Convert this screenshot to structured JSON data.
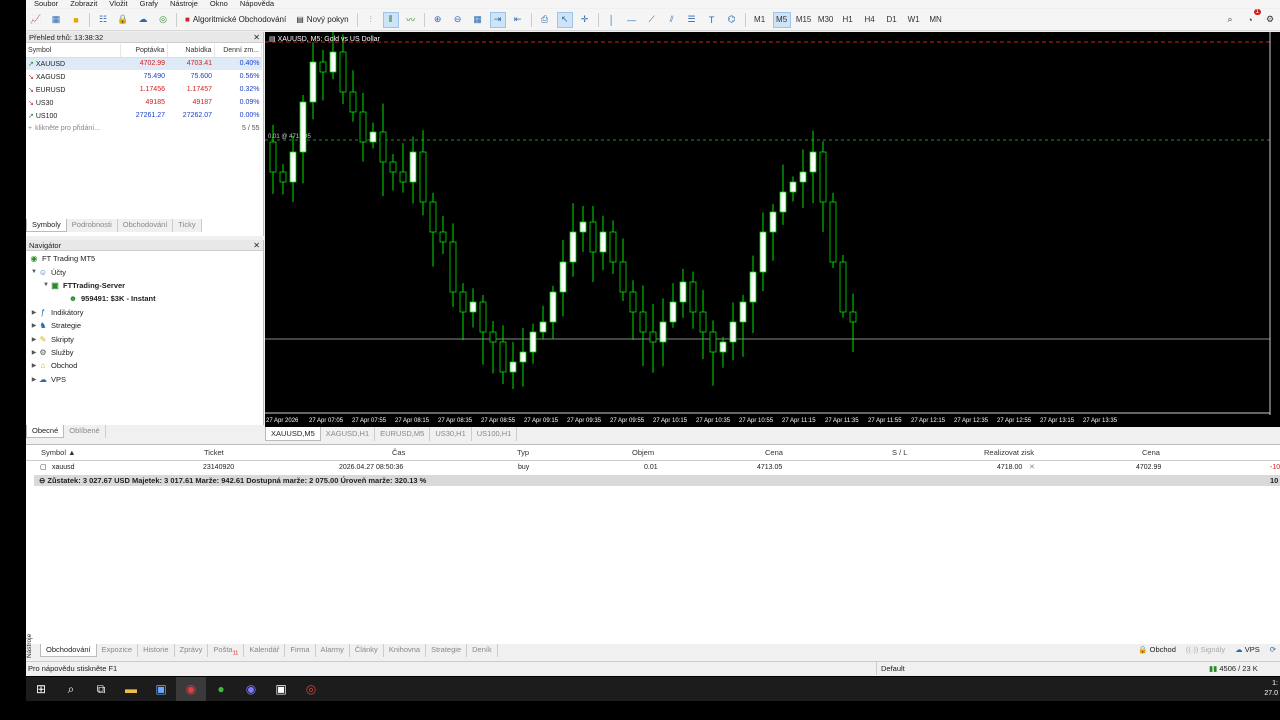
{
  "menu": [
    "Soubor",
    "Zobrazit",
    "Vložit",
    "Grafy",
    "Nástroje",
    "Okno",
    "Nápověda"
  ],
  "toolbar": {
    "algo_label": "Algoritmické Obchodování",
    "new_order_label": "Nový pokyn",
    "timeframes": [
      "M1",
      "M5",
      "M15",
      "M30",
      "H1",
      "H4",
      "D1",
      "W1",
      "MN"
    ],
    "active_timeframe": "M5",
    "notification_count": "1"
  },
  "market_watch": {
    "title": "Přehled trhů: 13:38:32",
    "columns": [
      "Symbol",
      "Poptávka",
      "Nabídka",
      "Denní zm..."
    ],
    "rows": [
      {
        "symbol": "XAUUSD",
        "bid": "4702.99",
        "ask": "4703.41",
        "change": "0.40%"
      },
      {
        "symbol": "XAGUSD",
        "bid": "75.490",
        "ask": "75.600",
        "change": "0.56%"
      },
      {
        "symbol": "EURUSD",
        "bid": "1.17456",
        "ask": "1.17457",
        "change": "0.32%"
      },
      {
        "symbol": "US30",
        "bid": "49185",
        "ask": "49187",
        "change": "0.09%"
      },
      {
        "symbol": "US100",
        "bid": "27261.27",
        "ask": "27262.07",
        "change": "0.00%"
      }
    ],
    "add_hint": "klikněte pro přidání...",
    "count": "5 / 55",
    "tabs": [
      "Symboly",
      "Podrobnosti",
      "Obchodování",
      "Ticky"
    ]
  },
  "navigator": {
    "title": "Navigátor",
    "root": "FT Trading MT5",
    "accounts": "Účty",
    "server": "FTTrading-Server",
    "account": "959491: $3K - Instant",
    "items": [
      "Indikátory",
      "Strategie",
      "Skripty",
      "Služby",
      "Obchod",
      "VPS"
    ],
    "tabs": [
      "Obecné",
      "Oblíbené"
    ]
  },
  "chart": {
    "title": "XAUUSD, M5:  Gold vs US Dollar",
    "price_labels": [
      "0.01 @ 4713.05"
    ],
    "time_labels": [
      "27 Apr 2026",
      "27 Apr 07:05",
      "27 Apr 07:55",
      "27 Apr 08:15",
      "27 Apr 08:35",
      "27 Apr 08:55",
      "27 Apr 09:15",
      "27 Apr 09:35",
      "27 Apr 09:55",
      "27 Apr 10:15",
      "27 Apr 10:35",
      "27 Apr 10:55",
      "27 Apr 11:15",
      "27 Apr 11:35",
      "27 Apr 11:55",
      "27 Apr 12:15",
      "27 Apr 12:35",
      "27 Apr 12:55",
      "27 Apr 13:15",
      "27 Apr 13:35"
    ]
  },
  "chart_tabs": [
    "XAUUSD,M5",
    "XAGUSD,H1",
    "EURUSD,M5",
    "US30,H1",
    "US100,H1"
  ],
  "trade": {
    "columns": [
      "Symbol",
      "Ticket",
      "Čas",
      "Typ",
      "Objem",
      "Cena",
      "S / L",
      "Realizovat zisk",
      "Cena"
    ],
    "row": {
      "symbol": "xauusd",
      "ticket": "23140920",
      "time": "2026.04.27 08:50:36",
      "type": "buy",
      "volume": "0.01",
      "price": "4713.05",
      "sl": "",
      "tp": "4718.00",
      "current": "4702.99",
      "profit": "-10"
    },
    "balance": "Zůstatek: 3 027.67 USD  Majetek: 3 017.61  Marže: 942.61  Dostupná marže: 2 075.00  Úroveň marže: 320.13 %",
    "balance_right": "10"
  },
  "bottom_tabs": [
    "Obchodování",
    "Expozice",
    "Historie",
    "Zprávy",
    "Pošta",
    "Kalendář",
    "Firma",
    "Alarmy",
    "Články",
    "Knihovna",
    "Strategie",
    "Deník"
  ],
  "mail_count": "11",
  "bottom_tools": [
    "Obchod",
    "Signály",
    "VPS"
  ],
  "vertical_label": "Nástroje",
  "status": {
    "help": "Pro nápovědu stiskněte F1",
    "profile": "Default",
    "traffic": "4506 / 23 K"
  },
  "taskbar": {
    "time": "1:",
    "date": "27.0"
  }
}
